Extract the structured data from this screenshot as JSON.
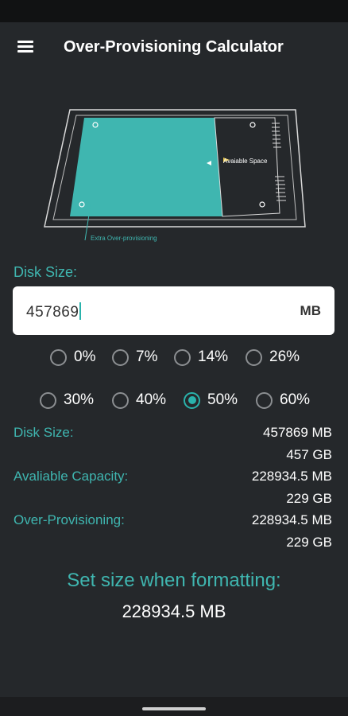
{
  "app": {
    "title": "Over-Provisioning Calculator"
  },
  "illustration": {
    "available_space_label": "Avaiable Space",
    "extra_label": "Extra Over-provisioning",
    "colors": {
      "teal": "#3fb6b0",
      "outline": "#d9d9d9"
    }
  },
  "input": {
    "label": "Disk Size:",
    "value": "457869",
    "unit": "MB"
  },
  "options": [
    {
      "label": "0%",
      "checked": false
    },
    {
      "label": "7%",
      "checked": false
    },
    {
      "label": "14%",
      "checked": false
    },
    {
      "label": "26%",
      "checked": false
    },
    {
      "label": "30%",
      "checked": false
    },
    {
      "label": "40%",
      "checked": false
    },
    {
      "label": "50%",
      "checked": true
    },
    {
      "label": "60%",
      "checked": false
    }
  ],
  "results": {
    "disk_size": {
      "label": "Disk Size:",
      "mb": "457869 MB",
      "gb": "457 GB"
    },
    "available": {
      "label": "Avaliable Capacity:",
      "mb": "228934.5 MB",
      "gb": "229 GB"
    },
    "overprov": {
      "label": "Over-Provisioning:",
      "mb": "228934.5 MB",
      "gb": "229 GB"
    }
  },
  "format": {
    "heading": "Set size when formatting:",
    "value": "228934.5 MB"
  },
  "colors": {
    "accent": "#3fb6b0",
    "background": "#25282b",
    "radio_off": "#8c8f92"
  }
}
